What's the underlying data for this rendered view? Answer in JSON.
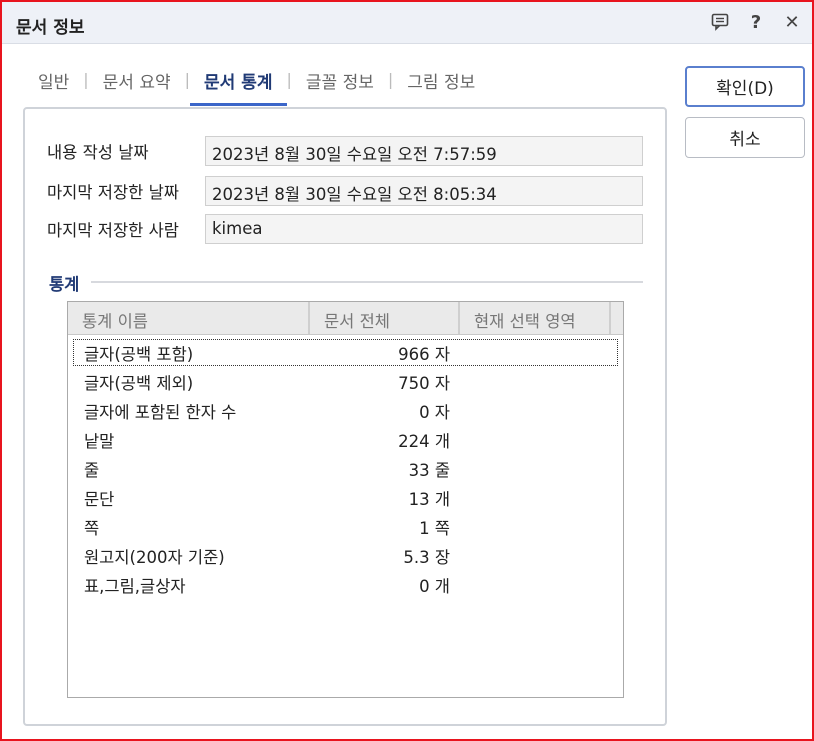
{
  "window": {
    "title": "문서 정보"
  },
  "titlebar_icons": [
    "chat-icon",
    "help-icon",
    "close-icon"
  ],
  "titlebar_glyphs": {
    "help": "?",
    "close": "✕"
  },
  "tabs": [
    {
      "label": "일반",
      "active": false
    },
    {
      "label": "문서 요약",
      "active": false
    },
    {
      "label": "문서 통계",
      "active": true
    },
    {
      "label": "글꼴 정보",
      "active": false
    },
    {
      "label": "그림 정보",
      "active": false
    }
  ],
  "tab_separator": "|",
  "info": {
    "created_label": "내용 작성 날짜",
    "created_value": "2023년 8월 30일 수요일 오전 7:57:59",
    "saved_label": "마지막 저장한 날짜",
    "saved_value": "2023년 8월 30일 수요일 오전 8:05:34",
    "saved_by_label": "마지막 저장한 사람",
    "saved_by_value": "kimea"
  },
  "stats": {
    "heading": "통계",
    "columns": [
      "통계 이름",
      "문서 전체",
      "현재 선택 영역"
    ],
    "rows": [
      {
        "name": "글자(공백 포함)",
        "total": "966 자",
        "selection": ""
      },
      {
        "name": "글자(공백 제외)",
        "total": "750 자",
        "selection": ""
      },
      {
        "name": "글자에 포함된 한자 수",
        "total": "0 자",
        "selection": ""
      },
      {
        "name": "낱말",
        "total": "224 개",
        "selection": ""
      },
      {
        "name": "줄",
        "total": "33 줄",
        "selection": ""
      },
      {
        "name": "문단",
        "total": "13 개",
        "selection": ""
      },
      {
        "name": "쪽",
        "total": "1 쪽",
        "selection": ""
      },
      {
        "name": "원고지(200자 기준)",
        "total": "5.3 장",
        "selection": ""
      },
      {
        "name": "표,그림,글상자",
        "total": "0 개",
        "selection": ""
      }
    ]
  },
  "buttons": {
    "ok_label": "확인(D)",
    "cancel_label": "취소"
  },
  "colors": {
    "accent": "#3b66c9",
    "border_highlight": "#e8141e",
    "heading": "#203a75"
  }
}
